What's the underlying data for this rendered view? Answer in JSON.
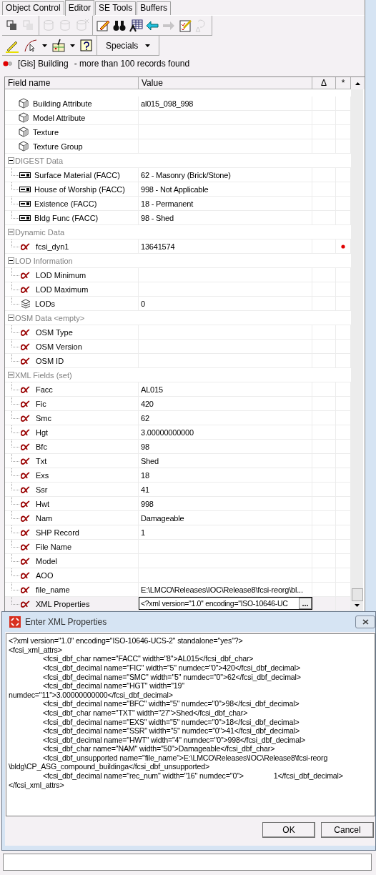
{
  "tabs": [
    {
      "label": "Object Control",
      "selected": false
    },
    {
      "label": "Editor",
      "selected": true
    },
    {
      "label": "SE Tools",
      "selected": false
    },
    {
      "label": "Buffers",
      "selected": false
    }
  ],
  "toolbar_1": [
    [
      {
        "kind": "objects",
        "disabled": false
      },
      {
        "kind": "objects",
        "disabled": true
      }
    ],
    [
      {
        "kind": "cylinder-in",
        "disabled": true
      },
      {
        "kind": "cylinder-cycle",
        "disabled": true
      },
      {
        "kind": "cylinder-x",
        "disabled": true
      }
    ],
    [
      {
        "kind": "edit",
        "disabled": false
      },
      {
        "kind": "binoculars",
        "disabled": false
      },
      {
        "kind": "table",
        "disabled": false
      },
      {
        "kind": "arrow-left",
        "disabled": false
      },
      {
        "kind": "arrow-right",
        "disabled": true
      },
      {
        "kind": "checklist",
        "disabled": false
      },
      {
        "kind": "undo",
        "disabled": true
      }
    ]
  ],
  "toolbar_2": {
    "tools": [
      {
        "kind": "pencil"
      },
      {
        "kind": "curve"
      },
      {
        "kind": "caret"
      },
      {
        "kind": "import"
      },
      {
        "kind": "caret"
      },
      {
        "kind": "help"
      }
    ],
    "menu": "Specials"
  },
  "status": {
    "layer": "[Gis] Building",
    "message": "- more than 100 records found"
  },
  "table": {
    "columns": [
      "Field name",
      "Value",
      "Δ",
      "*"
    ],
    "rows": [
      {
        "kind": "cube",
        "name": "Building Attribute",
        "value": "al015_098_998",
        "marked": false,
        "editing": false
      },
      {
        "kind": "cube",
        "name": "Model Attribute",
        "marked": false,
        "editing": false
      },
      {
        "kind": "cube",
        "name": "Texture",
        "marked": false,
        "editing": false
      },
      {
        "kind": "cube",
        "name": "Texture Group",
        "marked": false,
        "editing": false
      },
      {
        "kind": "group",
        "name": "DIGEST Data",
        "expanded": true,
        "children": [
          {
            "kind": "combo",
            "name": "Surface Material (FACC)",
            "value": "62 - Masonry (Brick/Stone)",
            "marked": false,
            "editing": false
          },
          {
            "kind": "combo",
            "name": "House of Worship (FACC)",
            "value": "998 - Not Applicable",
            "marked": false,
            "editing": false
          },
          {
            "kind": "combo",
            "name": "Existence (FACC)",
            "value": "18 - Permanent",
            "marked": false,
            "editing": false
          },
          {
            "kind": "combo",
            "name": "Bldg Func (FACC)",
            "value": "98 - Shed",
            "marked": false,
            "editing": false
          }
        ]
      },
      {
        "kind": "group",
        "name": "Dynamic Data",
        "expanded": true,
        "children": [
          {
            "kind": "alpha",
            "name": "fcsi_dyn1",
            "value": "13641574",
            "marked": true,
            "editing": false
          }
        ]
      },
      {
        "kind": "group",
        "name": "LOD Information",
        "expanded": true,
        "children": [
          {
            "kind": "alpha",
            "name": "LOD Minimum",
            "marked": false,
            "editing": false
          },
          {
            "kind": "alpha",
            "name": "LOD Maximum",
            "marked": false,
            "editing": false
          },
          {
            "kind": "layers",
            "name": "LODs",
            "value": "0",
            "marked": false,
            "editing": false
          }
        ]
      },
      {
        "kind": "group",
        "name": "OSM Data <empty>",
        "expanded": true,
        "children": [
          {
            "kind": "alpha",
            "name": "OSM Type",
            "marked": false,
            "editing": false
          },
          {
            "kind": "alpha",
            "name": "OSM Version",
            "marked": false,
            "editing": false
          },
          {
            "kind": "alpha",
            "name": "OSM ID",
            "marked": false,
            "editing": false
          }
        ]
      },
      {
        "kind": "group",
        "name": "XML Fields (set)",
        "expanded": true,
        "children": [
          {
            "kind": "alpha",
            "name": "Facc",
            "value": "AL015",
            "marked": false,
            "editing": false
          },
          {
            "kind": "alpha",
            "name": "Fic",
            "value": "420",
            "marked": false,
            "editing": false
          },
          {
            "kind": "alpha",
            "name": "Smc",
            "value": "62",
            "marked": false,
            "editing": false
          },
          {
            "kind": "alpha",
            "name": "Hgt",
            "value": "3.00000000000",
            "marked": false,
            "editing": false
          },
          {
            "kind": "alpha",
            "name": "Bfc",
            "value": "98",
            "marked": false,
            "editing": false
          },
          {
            "kind": "alpha",
            "name": "Txt",
            "value": "Shed",
            "marked": false,
            "editing": false
          },
          {
            "kind": "alpha",
            "name": "Exs",
            "value": "18",
            "marked": false,
            "editing": false
          },
          {
            "kind": "alpha",
            "name": "Ssr",
            "value": "41",
            "marked": false,
            "editing": false
          },
          {
            "kind": "alpha",
            "name": "Hwt",
            "value": "998",
            "marked": false,
            "editing": false
          },
          {
            "kind": "alpha",
            "name": "Nam",
            "value": "Damageable",
            "marked": false,
            "editing": false
          },
          {
            "kind": "alpha",
            "name": "SHP Record",
            "value": "1",
            "marked": false,
            "editing": false
          },
          {
            "kind": "alpha",
            "name": "File Name",
            "marked": false,
            "editing": false
          },
          {
            "kind": "alpha",
            "name": "Model",
            "marked": false,
            "editing": false
          },
          {
            "kind": "alpha",
            "name": "AOO",
            "marked": false,
            "editing": false
          },
          {
            "kind": "alpha",
            "name": "file_name",
            "value": "E:\\LMCO\\Releases\\IOC\\Release8\\fcsi-reorg\\bl...",
            "marked": false,
            "editing": false
          },
          {
            "kind": "alpha",
            "name": "XML Properties",
            "value": "<?xml version=\"1.0\" encoding=\"ISO-10646-UC",
            "marked": false,
            "editing": true,
            "edit_button": "..."
          }
        ]
      }
    ]
  },
  "dialog": {
    "title": "Enter XML Properties",
    "lines": [
      {
        "text": "<?xml version=\"1.0\" encoding=\"ISO-10646-UCS-2\" standalone=\"yes\"?>",
        "kind": "flush"
      },
      {
        "text": "<fcsi_xml_attrs>",
        "kind": "flush"
      },
      {
        "text": "<fcsi_dbf_char name=\"FACC\" width=\"8\">AL015</fcsi_dbf_char>",
        "kind": "indented"
      },
      {
        "text": "<fcsi_dbf_decimal name=\"FIC\" width=\"5\" numdec=\"0\">420</fcsi_dbf_decimal>",
        "kind": "indented"
      },
      {
        "text": "<fcsi_dbf_decimal name=\"SMC\" width=\"5\" numdec=\"0\">62</fcsi_dbf_decimal>",
        "kind": "indented"
      },
      {
        "text": "<fcsi_dbf_decimal name=\"HGT\" width=\"19\"",
        "kind": "indented"
      },
      {
        "text": "numdec=\"11\">3.00000000000</fcsi_dbf_decimal>",
        "kind": "flush"
      },
      {
        "text": "<fcsi_dbf_decimal name=\"BFC\" width=\"5\" numdec=\"0\">98</fcsi_dbf_decimal>",
        "kind": "indented"
      },
      {
        "text": "<fcsi_dbf_char name=\"TXT\" width=\"27\">Shed</fcsi_dbf_char>",
        "kind": "indented"
      },
      {
        "text": "<fcsi_dbf_decimal name=\"EXS\" width=\"5\" numdec=\"0\">18</fcsi_dbf_decimal>",
        "kind": "indented"
      },
      {
        "text": "<fcsi_dbf_decimal name=\"SSR\" width=\"5\" numdec=\"0\">41</fcsi_dbf_decimal>",
        "kind": "indented"
      },
      {
        "text": "<fcsi_dbf_decimal name=\"HWT\" width=\"4\" numdec=\"0\">998</fcsi_dbf_decimal>",
        "kind": "indented"
      },
      {
        "text": "<fcsi_dbf_char name=\"NAM\" width=\"50\">Damageable</fcsi_dbf_char>",
        "kind": "indented"
      },
      {
        "text": "<fcsi_dbf_unsupported name=\"file_name\">E:\\LMCO\\Releases\\IOC\\Release8\\fcsi-reorg",
        "kind": "indented"
      },
      {
        "text": "\\bldg\\CP_ASG_compound_buildinga</fcsi_dbf_unsupported>",
        "kind": "flush"
      },
      {
        "text": "<fcsi_dbf_decimal name=\"rec_num\" width=\"16\" numdec=\"0\">               1</fcsi_dbf_decimal>",
        "kind": "indented"
      },
      {
        "text": "</fcsi_xml_attrs>",
        "kind": "flush"
      }
    ],
    "buttons": [
      "OK",
      "Cancel"
    ]
  }
}
